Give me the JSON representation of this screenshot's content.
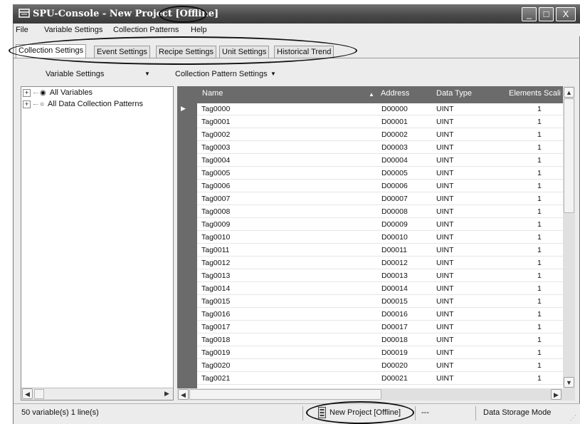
{
  "window": {
    "title": "SPU-Console - New Project [Offline]",
    "controls": {
      "minimize": "_",
      "maximize": "□",
      "close": "X"
    }
  },
  "menubar": {
    "items": [
      "File",
      "Variable Settings",
      "Collection Patterns",
      "Help"
    ]
  },
  "tabs": [
    {
      "label": "Collection Settings",
      "active": true
    },
    {
      "label": "Event Settings",
      "active": false
    },
    {
      "label": "Recipe Settings",
      "active": false
    },
    {
      "label": "Unit Settings",
      "active": false
    },
    {
      "label": "Historical Trend",
      "active": false
    }
  ],
  "toolbar": {
    "variable_settings": "Variable Settings",
    "collection_pattern_settings": "Collection Pattern Settings"
  },
  "tree": {
    "items": [
      {
        "label": "All Variables",
        "icon": "radio-filled-icon"
      },
      {
        "label": "All Data Collection Patterns",
        "icon": "radio-empty-icon"
      }
    ]
  },
  "grid": {
    "columns": [
      "Name",
      "Address",
      "Data Type",
      "Elements",
      "Scali"
    ],
    "sorted_column": "Name",
    "rows": [
      [
        "Tag0000",
        "D00000",
        "UINT",
        "1"
      ],
      [
        "Tag0001",
        "D00001",
        "UINT",
        "1"
      ],
      [
        "Tag0002",
        "D00002",
        "UINT",
        "1"
      ],
      [
        "Tag0003",
        "D00003",
        "UINT",
        "1"
      ],
      [
        "Tag0004",
        "D00004",
        "UINT",
        "1"
      ],
      [
        "Tag0005",
        "D00005",
        "UINT",
        "1"
      ],
      [
        "Tag0006",
        "D00006",
        "UINT",
        "1"
      ],
      [
        "Tag0007",
        "D00007",
        "UINT",
        "1"
      ],
      [
        "Tag0008",
        "D00008",
        "UINT",
        "1"
      ],
      [
        "Tag0009",
        "D00009",
        "UINT",
        "1"
      ],
      [
        "Tag0010",
        "D00010",
        "UINT",
        "1"
      ],
      [
        "Tag0011",
        "D00011",
        "UINT",
        "1"
      ],
      [
        "Tag0012",
        "D00012",
        "UINT",
        "1"
      ],
      [
        "Tag0013",
        "D00013",
        "UINT",
        "1"
      ],
      [
        "Tag0014",
        "D00014",
        "UINT",
        "1"
      ],
      [
        "Tag0015",
        "D00015",
        "UINT",
        "1"
      ],
      [
        "Tag0016",
        "D00016",
        "UINT",
        "1"
      ],
      [
        "Tag0017",
        "D00017",
        "UINT",
        "1"
      ],
      [
        "Tag0018",
        "D00018",
        "UINT",
        "1"
      ],
      [
        "Tag0019",
        "D00019",
        "UINT",
        "1"
      ],
      [
        "Tag0020",
        "D00020",
        "UINT",
        "1"
      ],
      [
        "Tag0021",
        "D00021",
        "UINT",
        "1"
      ]
    ]
  },
  "statusbar": {
    "counts": "50 variable(s)   1 line(s)",
    "project": "New Project [Offline]",
    "separator": "---",
    "mode": "Data Storage Mode"
  },
  "colors": {
    "titlebar": "#4a4a4a",
    "grid_header": "#6b6b6b",
    "window_bg": "#ececec"
  }
}
